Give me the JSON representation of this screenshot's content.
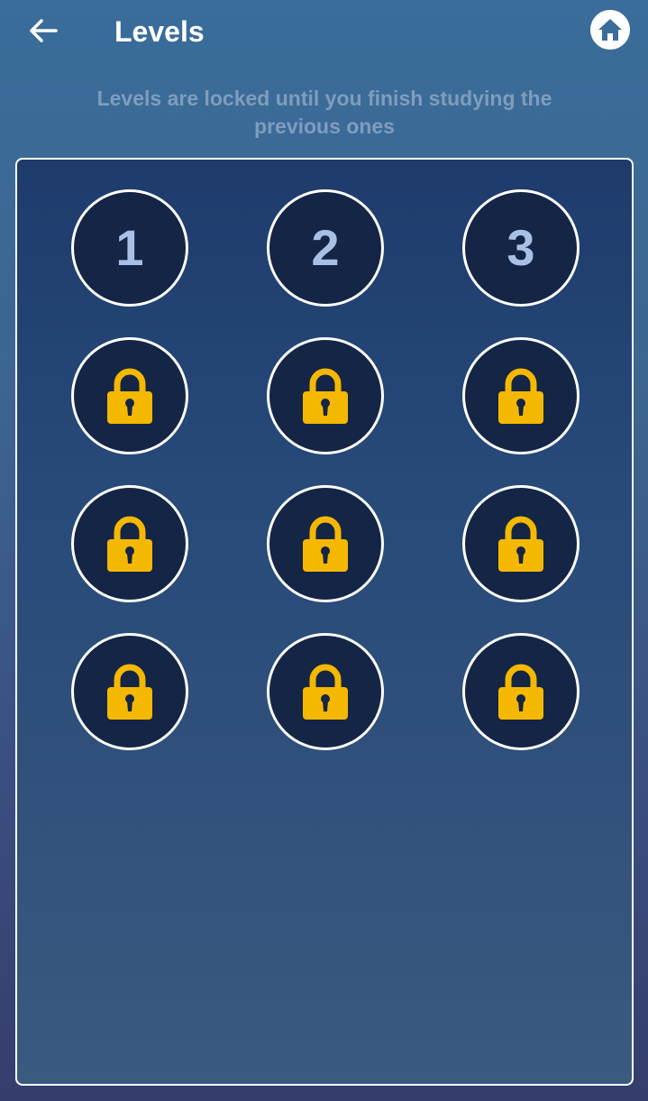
{
  "header": {
    "back_icon": "arrow-left-icon",
    "title": "Levels",
    "home_icon": "home-icon"
  },
  "subtitle": "Levels are locked until you finish studying the previous ones",
  "colors": {
    "lock": "#f5b800",
    "level_bg": "#142546",
    "level_number": "#a8c0e6",
    "border": "#ffffff"
  },
  "levels": [
    {
      "label": "1",
      "locked": false
    },
    {
      "label": "2",
      "locked": false
    },
    {
      "label": "3",
      "locked": false
    },
    {
      "label": "",
      "locked": true
    },
    {
      "label": "",
      "locked": true
    },
    {
      "label": "",
      "locked": true
    },
    {
      "label": "",
      "locked": true
    },
    {
      "label": "",
      "locked": true
    },
    {
      "label": "",
      "locked": true
    },
    {
      "label": "",
      "locked": true
    },
    {
      "label": "",
      "locked": true
    },
    {
      "label": "",
      "locked": true
    }
  ]
}
